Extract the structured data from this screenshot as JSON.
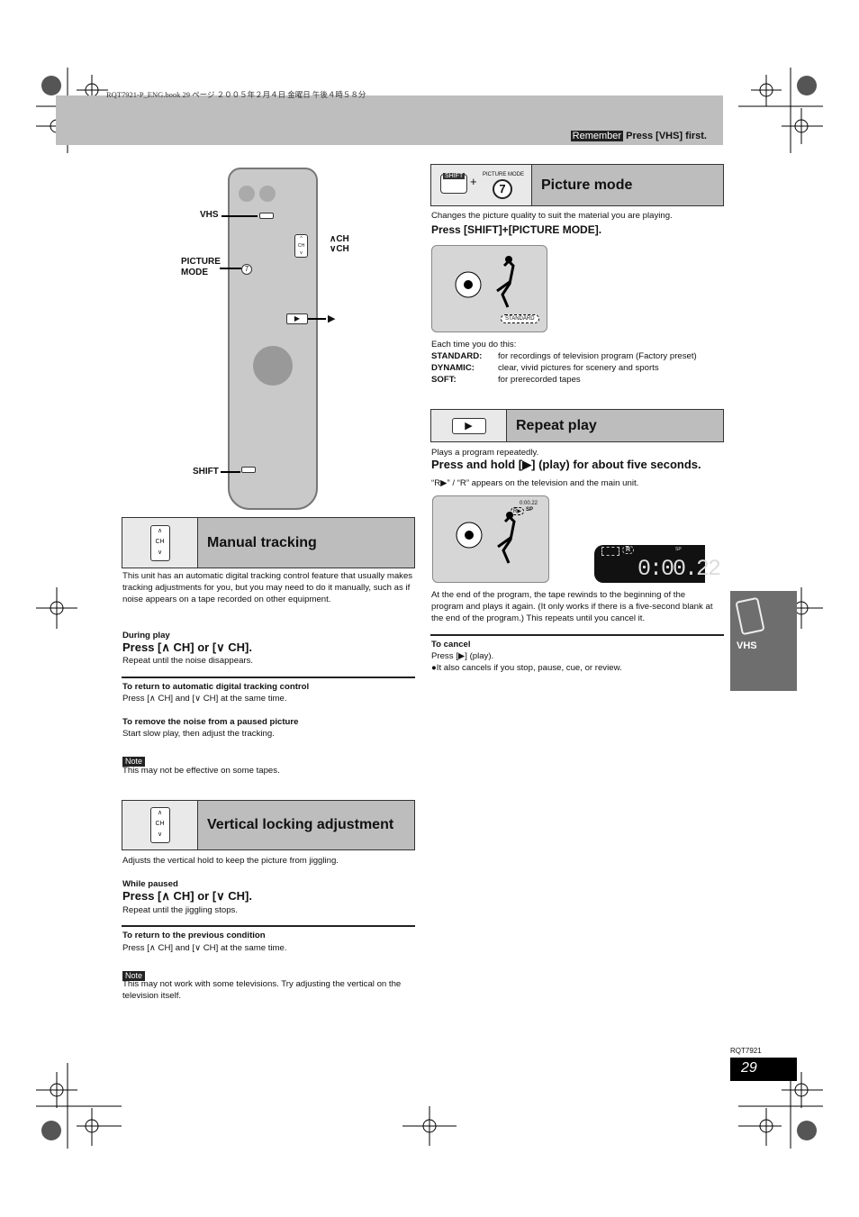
{
  "print_header": "RQT7921-P_ENG.book  29 ページ  ２００５年２月４日  金曜日  午後４時５８分",
  "top_bar": {
    "badge": "Remember",
    "text": "Press [VHS] first."
  },
  "remote": {
    "labels": {
      "vhs": "VHS",
      "ch_up": "CH",
      "ch_down": "CH",
      "picture_mode": "PICTURE MODE",
      "play": "▶",
      "shift": "SHIFT"
    }
  },
  "manual_tracking": {
    "title": "Manual tracking",
    "icon_label": "CH",
    "intro": "This unit has an automatic digital tracking control feature that usually makes tracking adjustments for you, but you may need to do it manually, such as if noise appears on a tape recorded on other equipment.",
    "during": "During play",
    "press": "Press [∧ CH] or [∨ CH].",
    "repeat": "Repeat until the noise disappears.",
    "return_h": "To return to automatic digital tracking control",
    "return_t": "Press [∧ CH] and [∨ CH] at the same time.",
    "remove_h": "To remove the noise from a paused picture",
    "remove_t": "Start slow play, then adjust the tracking.",
    "note_label": "Note",
    "note": "This may not be effective on some tapes."
  },
  "vertical_locking": {
    "title": "Vertical locking adjustment",
    "icon_label": "CH",
    "intro": "Adjusts the vertical hold to keep the picture from jiggling.",
    "while": "While paused",
    "press": "Press [∧ CH] or [∨ CH].",
    "repeat": "Repeat until the jiggling stops.",
    "return_h": "To return to the previous condition",
    "return_t": "Press [∧ CH] and [∨ CH] at the same time.",
    "note_label": "Note",
    "note": "This may not work with some televisions. Try adjusting the vertical on the television itself."
  },
  "picture_mode": {
    "title": "Picture mode",
    "icon_shift": "SHIFT",
    "icon_plus": "+",
    "icon_caption": "PICTURE MODE",
    "icon_num": "7",
    "intro": "Changes the picture quality to suit the material you are playing.",
    "press": "Press [SHIFT]+[PICTURE MODE].",
    "screen_label": "STANDARD",
    "each": "Each time you do this:",
    "modes": [
      {
        "name": "STANDARD:",
        "desc": "for recordings of television program (Factory preset)"
      },
      {
        "name": "DYNAMIC:",
        "desc": "clear, vivid pictures for scenery and sports"
      },
      {
        "name": "SOFT:",
        "desc": "for prerecorded tapes"
      }
    ]
  },
  "repeat_play": {
    "title": "Repeat play",
    "intro": "Plays a program repeatedly.",
    "press": "Press and hold [▶] (play) for about five seconds.",
    "appears": "“R▶” / “R” appears on the television and the main unit.",
    "osd_time": "0:00.22",
    "osd_rep": "R▶",
    "osd_sp": "SP",
    "display_time": "0:00.22",
    "display_r": "R",
    "display_sp": "SP",
    "end": "At the end of the program, the tape rewinds to the beginning of the program and plays it again. (It only works if there is a five-second blank at the end of the program.) This repeats until you cancel it.",
    "cancel_h": "To cancel",
    "cancel_t": "Press [▶] (play).",
    "cancel_b": "●It also cancels if you stop, pause, cue, or review."
  },
  "side_tab": {
    "label": "VHS"
  },
  "footer": {
    "code": "RQT7921",
    "page": "29"
  }
}
